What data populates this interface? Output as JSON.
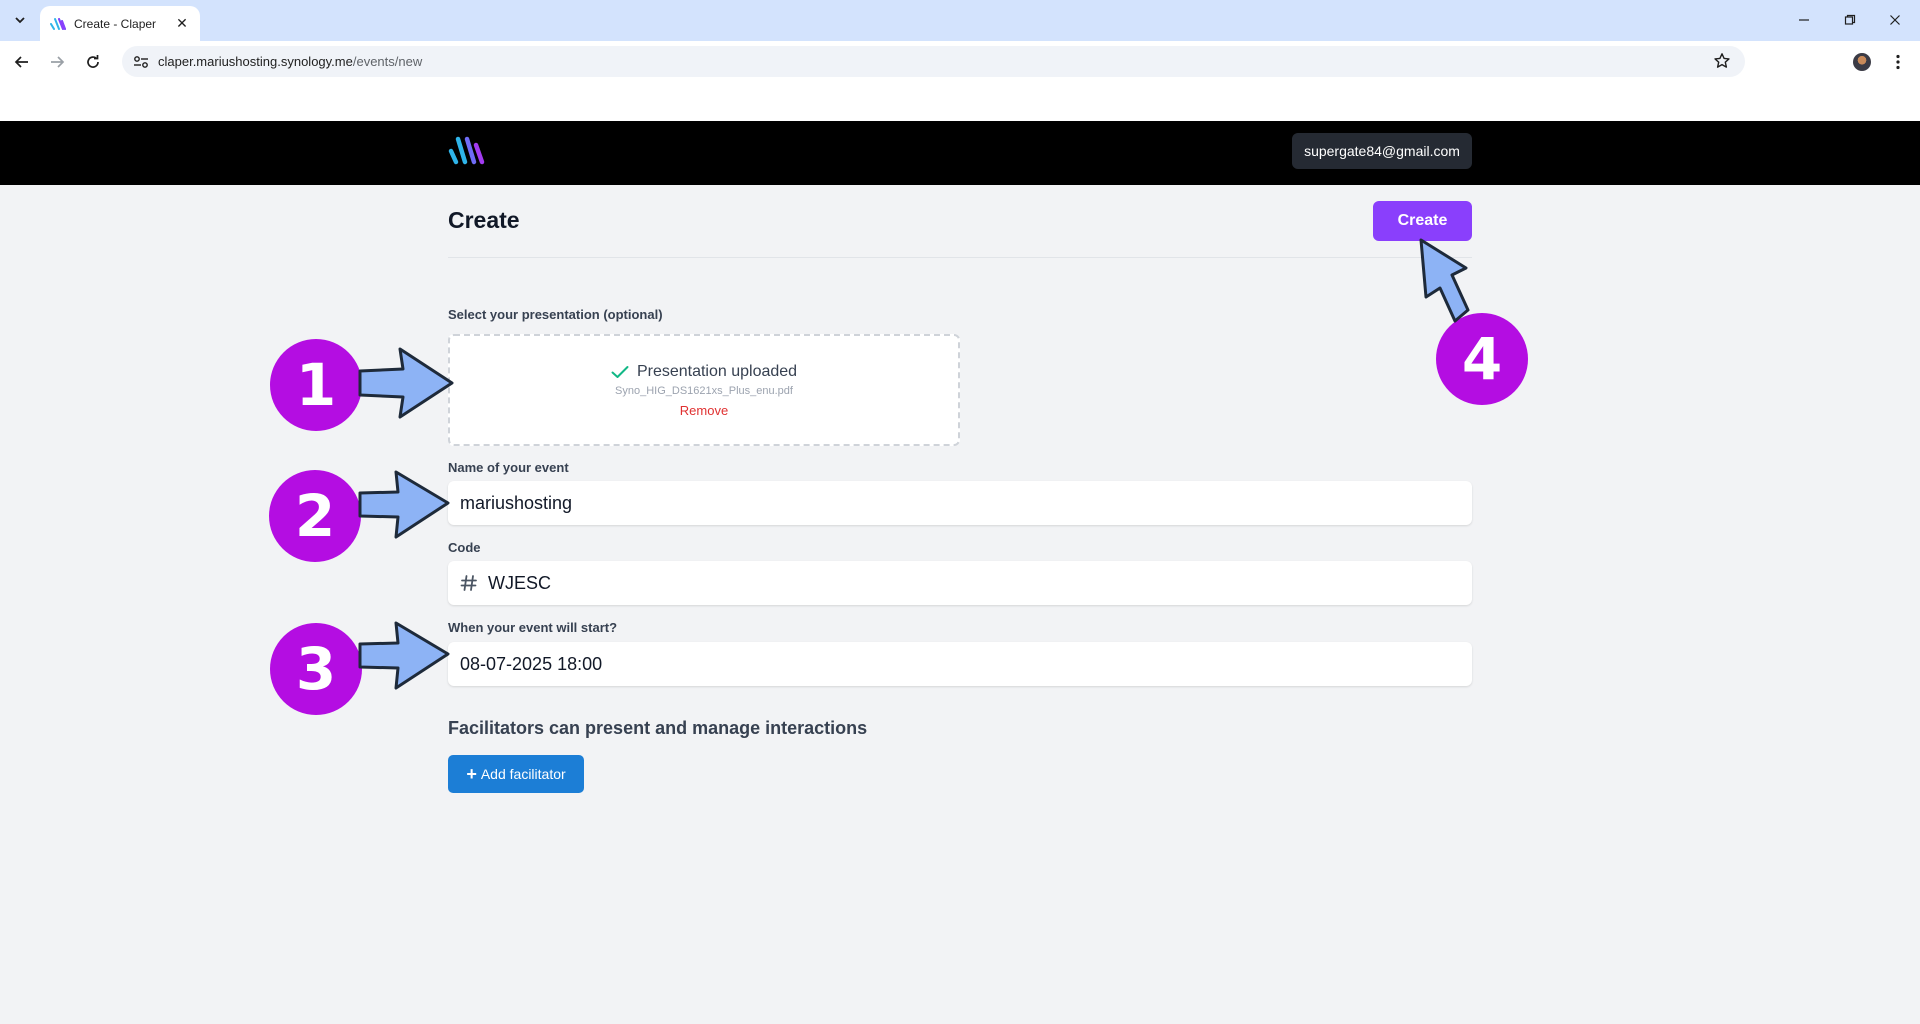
{
  "browser": {
    "tab_title": "Create - Claper",
    "url_host": "claper.mariushosting.synology.me",
    "url_path": "/events/new",
    "close_glyph": "✕"
  },
  "header": {
    "user_email": "supergate84@gmail.com"
  },
  "page": {
    "title": "Create",
    "create_button": "Create"
  },
  "presentation": {
    "label": "Select your presentation (optional)",
    "status": "Presentation uploaded",
    "filename": "Syno_HIG_DS1621xs_Plus_enu.pdf",
    "remove": "Remove"
  },
  "event_name": {
    "label": "Name of your event",
    "value": "mariushosting"
  },
  "code": {
    "label": "Code",
    "value": "WJESC"
  },
  "start": {
    "label": "When your event will start?",
    "value": "08-07-2025 18:00"
  },
  "facilitators": {
    "title": "Facilitators can present and manage interactions",
    "add_button": "Add facilitator",
    "plus": "+"
  },
  "annotations": {
    "badge_1": "1",
    "badge_2": "2",
    "badge_3": "3",
    "badge_4": "4",
    "badge_color": "#b40de2",
    "arrow_color": "#8db3f5"
  },
  "colors": {
    "create_accent": "#8a3ffc",
    "add_button": "#1c7ed6",
    "remove_text": "#e03131",
    "check": "#12b886"
  }
}
